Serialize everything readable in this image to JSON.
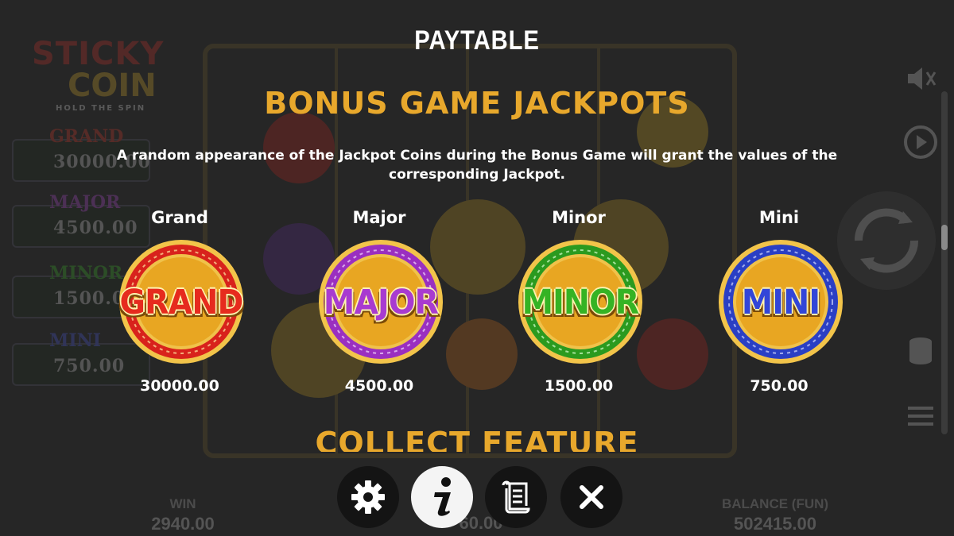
{
  "header": {
    "title": "PAYTABLE"
  },
  "section": {
    "title": "BONUS GAME JACKPOTS",
    "description": "A random appearance of the Jackpot Coins during the Bonus Game will grant the values of the corresponding Jackpot."
  },
  "jackpots": [
    {
      "name": "Grand",
      "coin_label": "GRAND",
      "amount": "30000.00",
      "ring_color": "#d8221c",
      "label_color": "#e62b1e"
    },
    {
      "name": "Major",
      "coin_label": "MAJOR",
      "amount": "4500.00",
      "ring_color": "#9a2fc0",
      "label_color": "#a83bd0"
    },
    {
      "name": "Minor",
      "coin_label": "MINOR",
      "amount": "1500.00",
      "ring_color": "#2b9a1f",
      "label_color": "#35b324"
    },
    {
      "name": "Mini",
      "coin_label": "MINI",
      "amount": "750.00",
      "ring_color": "#2a3fc4",
      "label_color": "#3246d8"
    }
  ],
  "next_section": {
    "title": "COLLECT FEATURE"
  },
  "background": {
    "logo_line1": "STICKY",
    "logo_line2": "COIN",
    "logo_sub": "HOLD THE SPIN",
    "jackpot_tags": [
      "GRAND",
      "MAJOR",
      "MINOR",
      "MINI"
    ],
    "jackpot_amounts": [
      "30000.00",
      "4500.00",
      "1500.00",
      "750.00"
    ],
    "win_label": "WIN",
    "win_value": "2940.00",
    "bet_value": "60.00",
    "balance_label": "BALANCE (FUN)",
    "balance_value": "502415.00"
  },
  "controls": [
    {
      "icon": "gear-icon",
      "active": false
    },
    {
      "icon": "info-icon",
      "active": true
    },
    {
      "icon": "scroll-icon",
      "active": false
    },
    {
      "icon": "close-icon",
      "active": false
    }
  ],
  "colors": {
    "accent_gold": "#e8a82c",
    "background": "#262626"
  }
}
